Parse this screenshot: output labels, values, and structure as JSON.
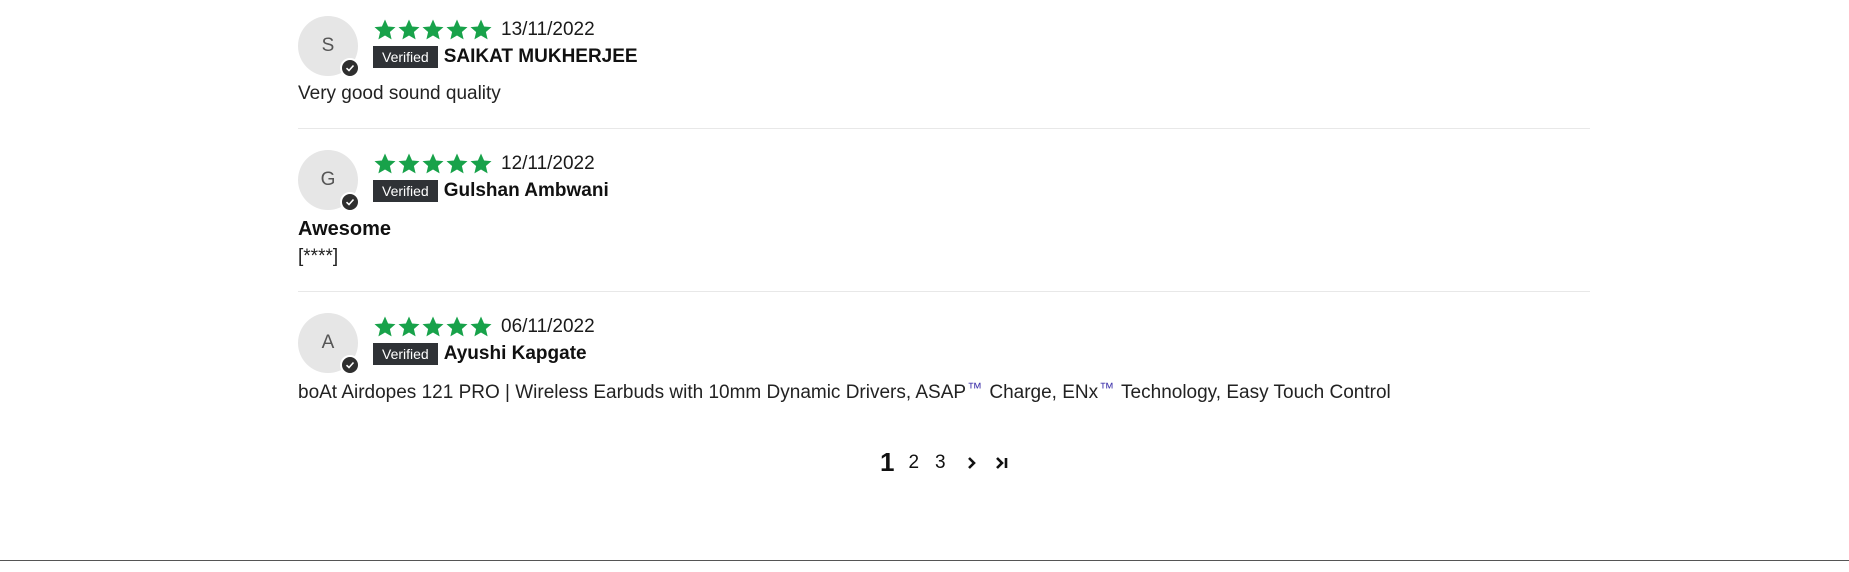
{
  "reviews": [
    {
      "initial": "S",
      "rating": 5,
      "date": "13/11/2022",
      "badge": "Verified",
      "name": "SAIKAT MUKHERJEE",
      "title": "",
      "body": "Very good sound quality"
    },
    {
      "initial": "G",
      "rating": 5,
      "date": "12/11/2022",
      "badge": "Verified",
      "name": "Gulshan Ambwani",
      "title": "Awesome",
      "body": "[****]"
    },
    {
      "initial": "A",
      "rating": 5,
      "date": "06/11/2022",
      "badge": "Verified",
      "name": "Ayushi Kapgate",
      "title": "",
      "body_parts": [
        "boAt Airdopes 121 PRO | Wireless Earbuds with 10mm Dynamic Drivers, ASAP",
        "™",
        " Charge, ENx",
        "™",
        " Technology, Easy Touch Control"
      ]
    }
  ],
  "pagination": {
    "current": "1",
    "pages": [
      "2",
      "3"
    ]
  },
  "colors": {
    "star": "#18a24a",
    "badge": "#2f3236",
    "tm": "#4a3fb0"
  },
  "icons": {
    "next": "chevron-right-icon",
    "last": "last-page-icon",
    "check": "check-icon"
  }
}
